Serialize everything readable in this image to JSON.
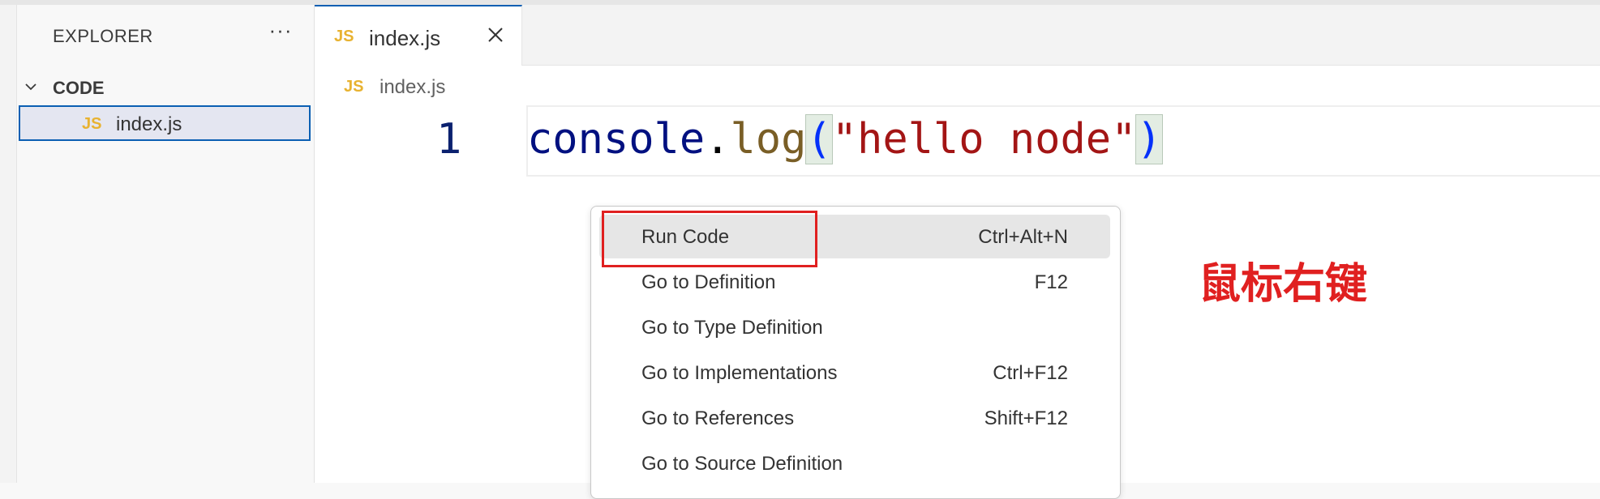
{
  "sidebar": {
    "title": "EXPLORER",
    "more_icon": "ellipsis-icon",
    "folder": {
      "label": "CODE",
      "icon": "chevron-down-icon"
    },
    "files": [
      {
        "badge": "JS",
        "label": "index.js"
      }
    ]
  },
  "tabs": [
    {
      "badge": "JS",
      "label": "index.js",
      "close_icon": "close-icon"
    }
  ],
  "breadcrumb": {
    "badge": "JS",
    "label": "index.js"
  },
  "editor": {
    "line_number": "1",
    "code": {
      "object": "console",
      "dot": ".",
      "method": "log",
      "open_paren": "(",
      "string": "\"hello node\"",
      "close_paren": ")"
    }
  },
  "context_menu": {
    "items": [
      {
        "label": "Run Code",
        "shortcut": "Ctrl+Alt+N"
      },
      {
        "label": "Go to Definition",
        "shortcut": "F12"
      },
      {
        "label": "Go to Type Definition",
        "shortcut": ""
      },
      {
        "label": "Go to Implementations",
        "shortcut": "Ctrl+F12"
      },
      {
        "label": "Go to References",
        "shortcut": "Shift+F12"
      },
      {
        "label": "Go to Source Definition",
        "shortcut": ""
      }
    ]
  },
  "annotation": "鼠标右键",
  "colors": {
    "accent": "#0a5fb3",
    "highlight_red": "#e02020",
    "js_badge": "#e8b230",
    "string": "#a31515",
    "function": "#795e26",
    "object": "#001080"
  }
}
